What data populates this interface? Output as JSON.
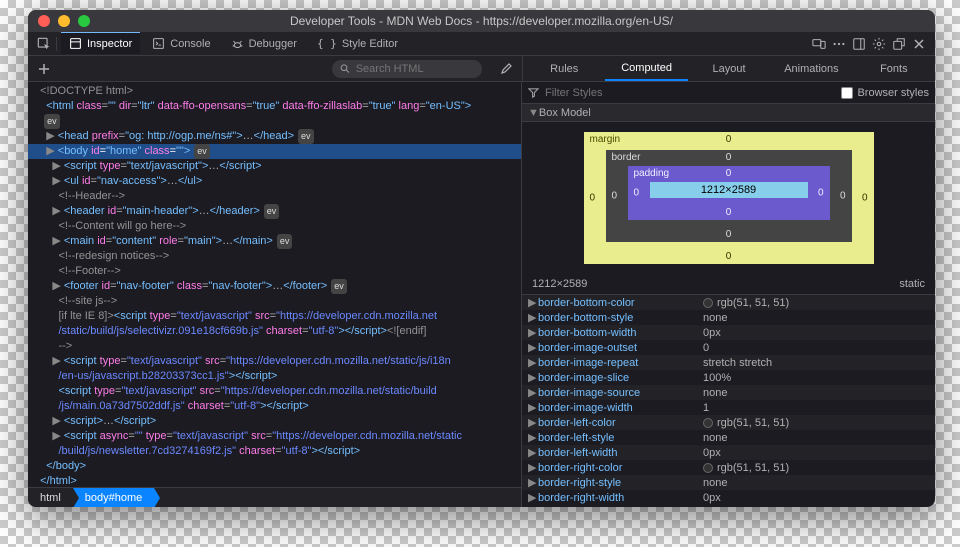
{
  "title": "Developer Tools - MDN Web Docs - https://developer.mozilla.org/en-US/",
  "toolbar": {
    "inspector": "Inspector",
    "console": "Console",
    "debugger": "Debugger",
    "style_editor": "Style Editor"
  },
  "subbar": {
    "search_placeholder": "Search HTML",
    "rules": "Rules",
    "computed": "Computed",
    "layout": "Layout",
    "animations": "Animations",
    "fonts": "Fonts"
  },
  "dom": [
    {
      "indent": 0,
      "type": "doctype",
      "text": "<!DOCTYPE html>"
    },
    {
      "indent": 0,
      "type": "open",
      "tag": "html",
      "attrs": [
        [
          "class",
          ""
        ],
        [
          "dir",
          "ltr"
        ],
        [
          "data-ffo-opensans",
          "true"
        ],
        [
          "data-ffo-zillaslab",
          "true"
        ],
        [
          "lang",
          "en-US"
        ]
      ]
    },
    {
      "indent": 0,
      "type": "ev"
    },
    {
      "indent": 1,
      "type": "openclose",
      "tw": true,
      "tag": "head",
      "attrs": [
        [
          "prefix",
          "og: http://ogp.me/ns#"
        ]
      ],
      "inner": "…",
      "ev": true
    },
    {
      "indent": 1,
      "type": "open",
      "tw": true,
      "sel": true,
      "tag": "body",
      "attrs": [
        [
          "id",
          "home"
        ],
        [
          "class",
          ""
        ]
      ],
      "ev": true
    },
    {
      "indent": 2,
      "type": "openclose",
      "tw": true,
      "tag": "script",
      "attrs": [
        [
          "type",
          "text/javascript"
        ]
      ],
      "inner": "…"
    },
    {
      "indent": 2,
      "type": "openclose",
      "tw": true,
      "tag": "ul",
      "attrs": [
        [
          "id",
          "nav-access"
        ]
      ],
      "inner": "…"
    },
    {
      "indent": 2,
      "type": "comment",
      "text": "<!--Header-->"
    },
    {
      "indent": 2,
      "type": "openclose",
      "tw": true,
      "tag": "header",
      "attrs": [
        [
          "id",
          "main-header"
        ]
      ],
      "inner": "…",
      "ev": true
    },
    {
      "indent": 2,
      "type": "comment",
      "text": "<!--Content will go here-->"
    },
    {
      "indent": 2,
      "type": "openclose",
      "tw": true,
      "tag": "main",
      "attrs": [
        [
          "id",
          "content"
        ],
        [
          "role",
          "main"
        ]
      ],
      "inner": "…",
      "ev": true
    },
    {
      "indent": 2,
      "type": "comment",
      "text": "<!--redesign notices-->"
    },
    {
      "indent": 2,
      "type": "comment",
      "text": "<!--Footer-->"
    },
    {
      "indent": 2,
      "type": "openclose",
      "tw": true,
      "tag": "footer",
      "attrs": [
        [
          "id",
          "nav-footer"
        ],
        [
          "class",
          "nav-footer"
        ]
      ],
      "inner": "…",
      "ev": true
    },
    {
      "indent": 2,
      "type": "comment",
      "text": "<!--site js-->"
    },
    {
      "indent": 2,
      "type": "raw",
      "html": "<span class='comment'>[if lte IE 8]&gt;</span><span class='tag'>&lt;script</span> <span class='attr'>type</span>=<span class='str'>\"text/javascript\"</span> <span class='attr'>src</span>=<span class='str'>\"https://developer.cdn.mozilla.net</span>"
    },
    {
      "indent": 2,
      "type": "raw",
      "html": "<span class='str'>/static/build/js/selectivizr.091e18cf669b.js\"</span> <span class='attr'>charset</span>=<span class='str'>\"utf-8\"</span><span class='tag'>&gt;&lt;/script&gt;</span><span class='comment'>&lt;![endif]</span>"
    },
    {
      "indent": 2,
      "type": "comment",
      "text": "-->"
    },
    {
      "indent": 2,
      "type": "raw",
      "tw": true,
      "html": "<span class='tag'>&lt;script</span> <span class='attr'>type</span>=<span class='str'>\"text/javascript\"</span> <span class='attr'>src</span>=<span class='str'>\"https://developer.cdn.mozilla.net/static/js/i18n</span>"
    },
    {
      "indent": 2,
      "type": "raw",
      "html": "<span class='str'>/en-us/javascript.b28203373cc1.js\"</span><span class='tag'>&gt;&lt;/script&gt;</span>"
    },
    {
      "indent": 2,
      "type": "raw",
      "html": "<span class='tag'>&lt;script</span> <span class='attr'>type</span>=<span class='str'>\"text/javascript\"</span> <span class='attr'>src</span>=<span class='str'>\"https://developer.cdn.mozilla.net/static/build</span>"
    },
    {
      "indent": 2,
      "type": "raw",
      "html": "<span class='str'>/js/main.0a73d7502ddf.js\"</span> <span class='attr'>charset</span>=<span class='str'>\"utf-8\"</span><span class='tag'>&gt;&lt;/script&gt;</span>"
    },
    {
      "indent": 2,
      "type": "openclose",
      "tw": true,
      "tag": "script",
      "inner": "…"
    },
    {
      "indent": 2,
      "type": "raw",
      "tw": true,
      "html": "<span class='tag'>&lt;script</span> <span class='attr'>async</span>=<span class='str'>\"\"</span> <span class='attr'>type</span>=<span class='str'>\"text/javascript\"</span> <span class='attr'>src</span>=<span class='str'>\"https://developer.cdn.mozilla.net/static</span>"
    },
    {
      "indent": 2,
      "type": "raw",
      "html": "<span class='str'>/build/js/newsletter.7cd3274169f2.js\"</span> <span class='attr'>charset</span>=<span class='str'>\"utf-8\"</span><span class='tag'>&gt;&lt;/script&gt;</span>"
    },
    {
      "indent": 1,
      "type": "close",
      "tag": "body"
    },
    {
      "indent": 0,
      "type": "close",
      "tag": "html"
    }
  ],
  "crumbs": [
    "html",
    "body#home"
  ],
  "filter_placeholder": "Filter Styles",
  "browser_styles": "Browser styles",
  "boxmodel": {
    "title": "Box Model",
    "margin": [
      0,
      0,
      0,
      0
    ],
    "border": [
      0,
      0,
      0,
      0
    ],
    "padding": [
      0,
      0,
      0,
      0
    ],
    "size": "1212×2589",
    "margin_label": "margin",
    "border_label": "border",
    "padding_label": "padding"
  },
  "sizebar": {
    "left": "1212×2589",
    "right": "static"
  },
  "props": [
    {
      "name": "border-bottom-color",
      "value": "rgb(51, 51, 51)",
      "swatch": true
    },
    {
      "name": "border-bottom-style",
      "value": "none"
    },
    {
      "name": "border-bottom-width",
      "value": "0px"
    },
    {
      "name": "border-image-outset",
      "value": "0"
    },
    {
      "name": "border-image-repeat",
      "value": "stretch stretch"
    },
    {
      "name": "border-image-slice",
      "value": "100%"
    },
    {
      "name": "border-image-source",
      "value": "none"
    },
    {
      "name": "border-image-width",
      "value": "1"
    },
    {
      "name": "border-left-color",
      "value": "rgb(51, 51, 51)",
      "swatch": true
    },
    {
      "name": "border-left-style",
      "value": "none"
    },
    {
      "name": "border-left-width",
      "value": "0px"
    },
    {
      "name": "border-right-color",
      "value": "rgb(51, 51, 51)",
      "swatch": true
    },
    {
      "name": "border-right-style",
      "value": "none"
    },
    {
      "name": "border-right-width",
      "value": "0px"
    }
  ]
}
